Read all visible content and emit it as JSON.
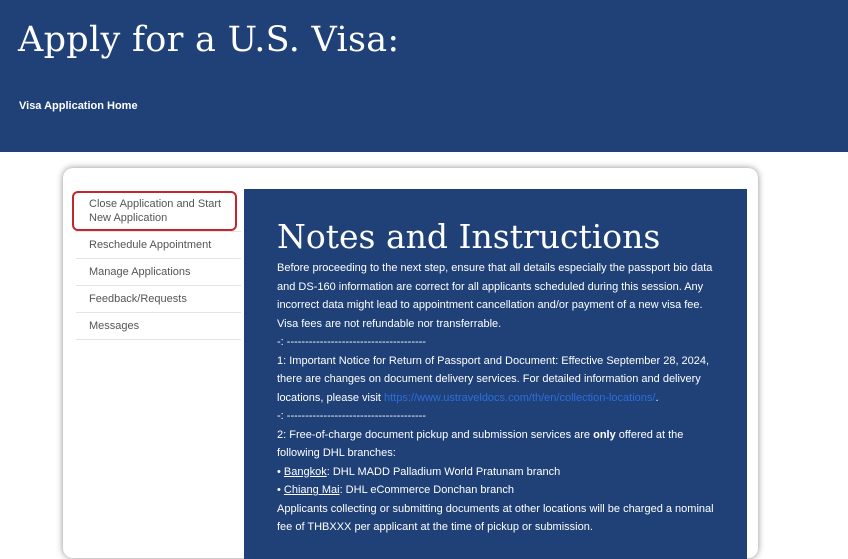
{
  "header": {
    "title": "Apply for a U.S. Visa:",
    "breadcrumb": "Visa Application Home"
  },
  "sidebar": {
    "items": [
      {
        "label": "Close Application and Start New Application",
        "highlighted": true
      },
      {
        "label": "Reschedule Appointment"
      },
      {
        "label": "Manage Applications"
      },
      {
        "label": "Feedback/Requests"
      },
      {
        "label": "Messages"
      }
    ]
  },
  "notes": {
    "title": "Notes and Instructions",
    "intro": "Before proceeding to the next step, ensure that all details especially the passport bio data and DS-160 information are correct for all applicants scheduled during this session. Any incorrect data might lead to appointment cancellation and/or payment of a new visa fee. Visa fees are not refundable nor transferrable.",
    "separator_1": "-:  --------------------------------------",
    "notice_1_text": "1: Important Notice for Return of Passport and Document: Effective September 28, 2024, there are changes on document delivery services. For detailed information and delivery locations, please visit ",
    "notice_1_link": "https://www.ustraveldocs.com/th/en/collection-locations/",
    "notice_1_end": ".",
    "separator_2": "-:  --------------------------------------",
    "notice_2_pre": "2: Free-of-charge document pickup and submission services are ",
    "notice_2_bold": "only",
    "notice_2_post": " offered at the following DHL branches:",
    "branch_1_bullet": "• ",
    "branch_1_city": "Bangkok",
    "branch_1_detail": ": DHL MADD Palladium World Pratunam branch",
    "branch_2_bullet": "• ",
    "branch_2_city": "Chiang Mai",
    "branch_2_detail": ": DHL eCommerce Donchan branch",
    "fee_note": "Applicants collecting or submitting documents at other locations will be charged a nominal fee of THBXXX per applicant at the time of pickup or submission."
  },
  "colors": {
    "header_bg": "#1f4178",
    "panel_bg": "#1f4178",
    "highlight": "#c0282e",
    "link": "#2f6ddc"
  }
}
